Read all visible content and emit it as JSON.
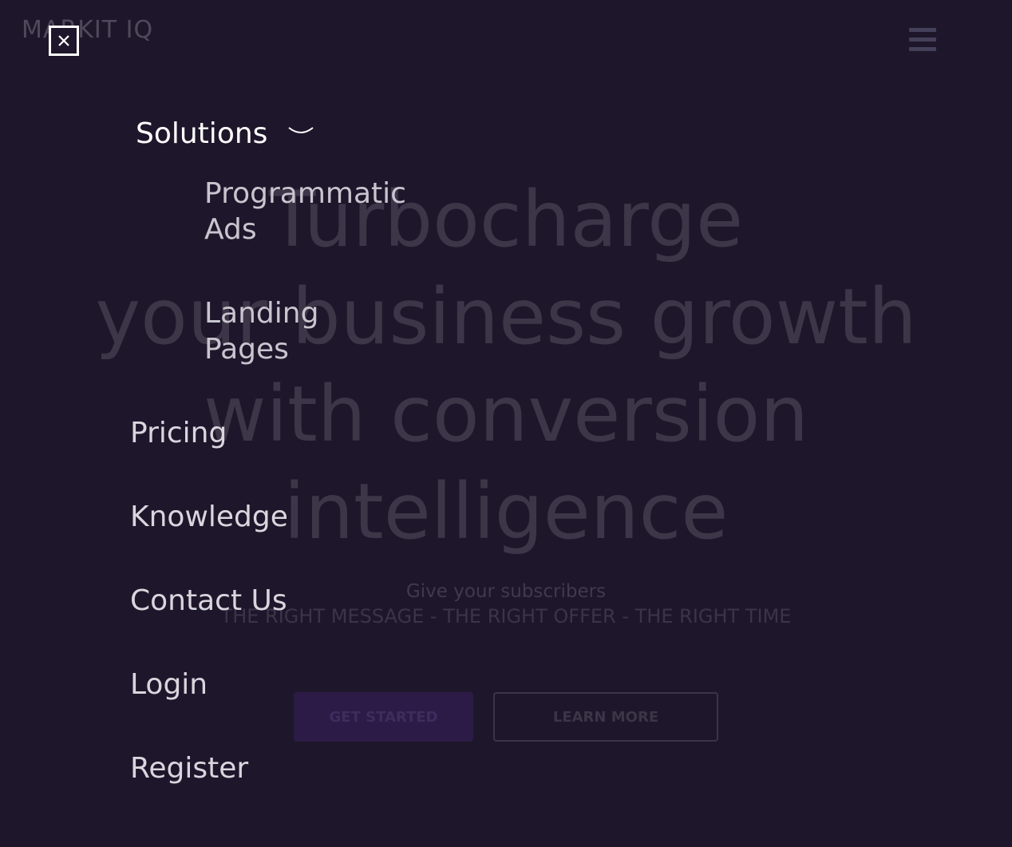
{
  "header": {
    "logo": "MARKIT IQ"
  },
  "hero": {
    "title_lines": [
      "Turbocharge",
      "your business growth",
      "with conversion",
      "intelligence"
    ],
    "subtitle": "Give your subscribers",
    "tagline": "THE RIGHT MESSAGE - THE RIGHT OFFER - THE RIGHT TIME",
    "primary_button": "GET STARTED",
    "secondary_button": "LEARN MORE"
  },
  "menu": {
    "solutions_label": "Solutions",
    "submenu": [
      {
        "line1": "Programmatic",
        "line2": "Ads"
      },
      {
        "line1": "Landing",
        "line2": "Pages"
      }
    ],
    "items": [
      "Pricing",
      "Knowledge",
      "Contact Us",
      "Login",
      "Register"
    ]
  },
  "colors": {
    "background": "#1e172b",
    "menu_text": "#d8d6de",
    "active_text": "#ffffff",
    "primary_button": "#2c1b47"
  },
  "icons": {
    "close": "close-icon",
    "chevron": "chevron-down-icon",
    "menu": "hamburger-icon"
  }
}
